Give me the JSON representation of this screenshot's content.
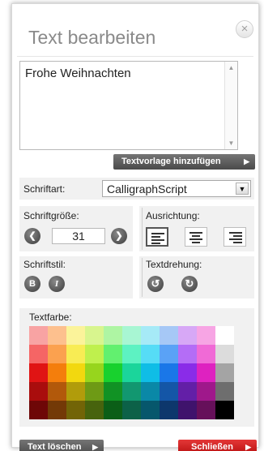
{
  "dialog": {
    "title": "Text bearbeiten",
    "close_glyph": "×"
  },
  "text_area": {
    "value": "Frohe Weihnachten"
  },
  "buttons": {
    "add_template": "Textvorlage hinzufügen",
    "clear_text": "Text löschen",
    "close": "Schließen"
  },
  "font": {
    "label": "Schriftart:",
    "selected": "CalligraphScript"
  },
  "font_size": {
    "label": "Schriftgröße:",
    "value": "31"
  },
  "alignment": {
    "label": "Ausrichtung:",
    "options": [
      "left",
      "center",
      "right"
    ],
    "selected": "left"
  },
  "font_style": {
    "label": "Schriftstil:",
    "bold": "B",
    "italic": "I"
  },
  "rotation": {
    "label": "Textdrehung:"
  },
  "text_color": {
    "label": "Textfarbe:",
    "palette": [
      [
        "#f8a3a3",
        "#fdc08e",
        "#fbf39a",
        "#d8f58e",
        "#aef5a3",
        "#a8f6d3",
        "#a6eaf7",
        "#a6c8f6",
        "#d7a8f6",
        "#f7a5e4",
        "#ffffff"
      ],
      [
        "#f56565",
        "#fba14f",
        "#f8ec54",
        "#bff04d",
        "#62f06f",
        "#5df2c2",
        "#56dcf6",
        "#5aa2f6",
        "#b46df6",
        "#f06ad6",
        "#dcdcdc"
      ],
      [
        "#e01414",
        "#f47e0c",
        "#f2d80f",
        "#97d51d",
        "#18d12e",
        "#1bd59b",
        "#0fbde6",
        "#1a77e8",
        "#8a2ce8",
        "#de22c0",
        "#a4a4a4"
      ],
      [
        "#a90d0d",
        "#b2590b",
        "#b19c0b",
        "#6e9a15",
        "#119224",
        "#129770",
        "#0a88a7",
        "#1456a7",
        "#631fa7",
        "#9f188b",
        "#6e6e6e"
      ],
      [
        "#6e0707",
        "#733907",
        "#726407",
        "#47630d",
        "#0b5e17",
        "#0c6148",
        "#06576c",
        "#0d376c",
        "#3f136c",
        "#66105a",
        "#000000"
      ]
    ]
  },
  "icons": {
    "prev": "chevron-left-icon",
    "next": "chevron-right-icon",
    "rotate_ccw": "rotate-left-icon",
    "rotate_cw": "rotate-right-icon"
  }
}
